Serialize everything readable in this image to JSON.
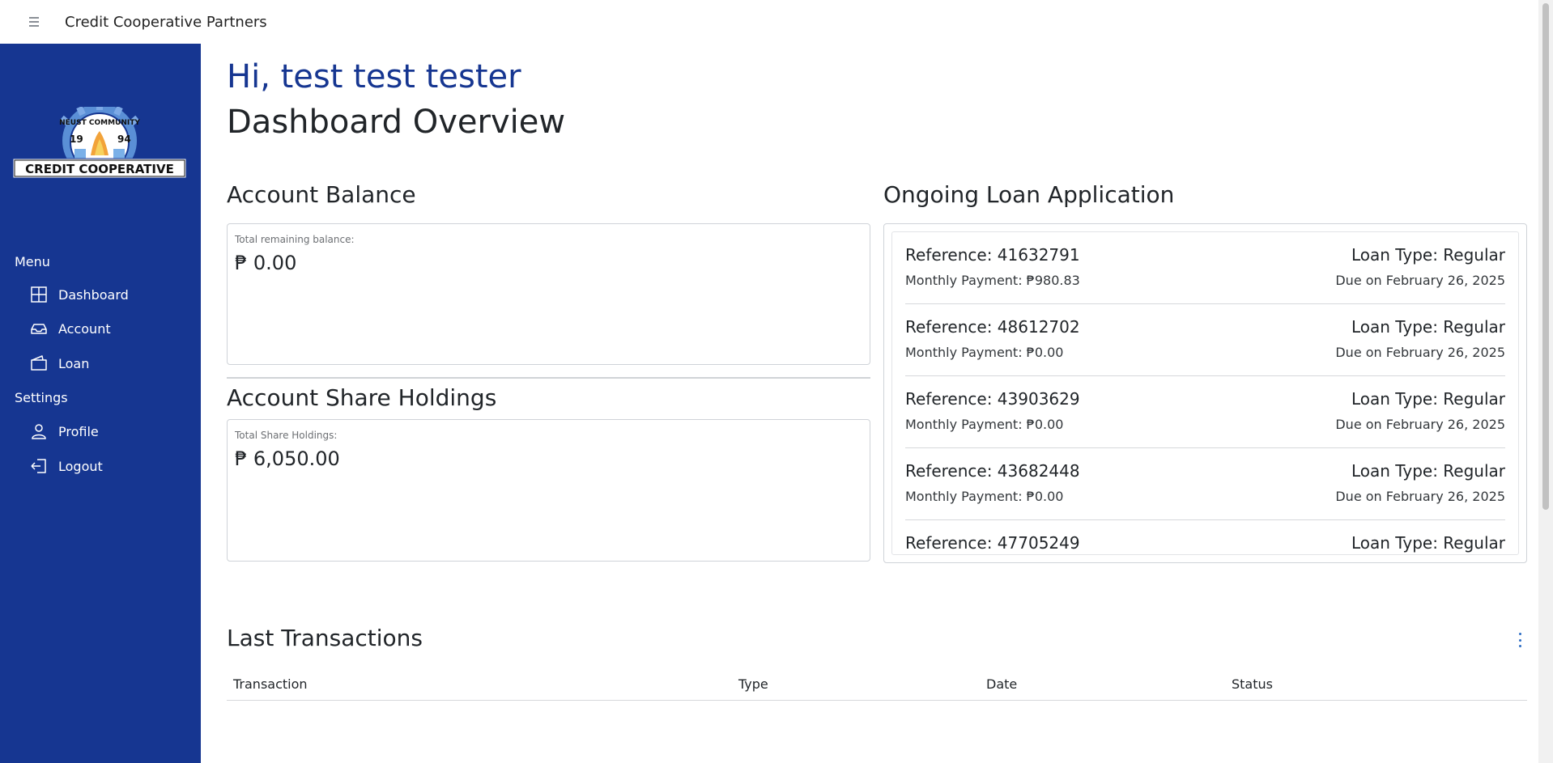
{
  "header": {
    "menu_icon": "hamburger-icon",
    "title": "Credit Cooperative Partners"
  },
  "sidebar": {
    "bg_color": "#163691",
    "logo": {
      "arc_text": "NEUST COMMUNITY",
      "year_left": "19",
      "year_right": "94",
      "banner_text": "CREDIT COOPERATIVE"
    },
    "menu_label": "Menu",
    "settings_label": "Settings",
    "menu_items": [
      {
        "label": "Dashboard",
        "icon": "dashboard-grid-icon"
      },
      {
        "label": "Account",
        "icon": "inbox-tray-icon"
      },
      {
        "label": "Loan",
        "icon": "wallet-icon"
      }
    ],
    "settings_items": [
      {
        "label": "Profile",
        "icon": "person-icon"
      },
      {
        "label": "Logout",
        "icon": "logout-icon"
      }
    ]
  },
  "main": {
    "greeting": "Hi, test test tester",
    "page_title": "Dashboard Overview",
    "account_balance": {
      "title": "Account Balance",
      "caption": "Total remaining balance:",
      "amount": "₱ 0.00"
    },
    "share_holdings": {
      "title": "Account Share Holdings",
      "caption": "Total Share Holdings:",
      "amount": "₱ 6,050.00"
    },
    "loans": {
      "title": "Ongoing Loan Application",
      "items": [
        {
          "reference": "Reference: 41632791",
          "loan_type": "Loan Type: Regular",
          "monthly_payment": "Monthly Payment: ₱980.83",
          "due": "Due on February 26, 2025"
        },
        {
          "reference": "Reference: 48612702",
          "loan_type": "Loan Type: Regular",
          "monthly_payment": "Monthly Payment: ₱0.00",
          "due": "Due on February 26, 2025"
        },
        {
          "reference": "Reference: 43903629",
          "loan_type": "Loan Type: Regular",
          "monthly_payment": "Monthly Payment: ₱0.00",
          "due": "Due on February 26, 2025"
        },
        {
          "reference": "Reference: 43682448",
          "loan_type": "Loan Type: Regular",
          "monthly_payment": "Monthly Payment: ₱0.00",
          "due": "Due on February 26, 2025"
        },
        {
          "reference": "Reference: 47705249",
          "loan_type": "Loan Type: Regular",
          "monthly_payment": "",
          "due": ""
        }
      ]
    },
    "transactions": {
      "title": "Last Transactions",
      "more_icon": "kebab-menu-icon",
      "columns": [
        "Transaction",
        "Type",
        "Date",
        "Status"
      ]
    }
  }
}
